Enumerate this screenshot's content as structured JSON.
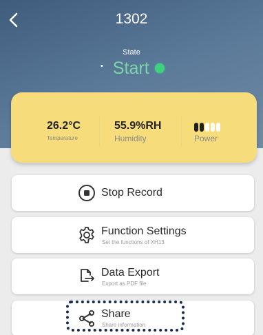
{
  "header": {
    "title": "1302",
    "state_label": "State",
    "state_value": "Start"
  },
  "stats": {
    "temperature_value": "26.2°C",
    "temperature_label": "Temperature",
    "humidity_value": "55.9%RH",
    "humidity_label": "Humidity",
    "power_label": "Power",
    "power_level": 0.4
  },
  "actions": [
    {
      "label": "Stop Record",
      "sub": "",
      "icon": "stop-circle-icon"
    },
    {
      "label": "Function Settings",
      "sub": "Set the functions of XH13",
      "icon": "gear-icon"
    },
    {
      "label": "Data Export",
      "sub": "Export as PDF file",
      "icon": "export-icon"
    },
    {
      "label": "Share",
      "sub": "Share information",
      "icon": "share-icon"
    }
  ],
  "colors": {
    "header": "#4b6a8c",
    "stats_card": "#f6dc7a",
    "state_text": "#7ad6a8",
    "state_dot": "#3fd27e",
    "highlight_border": "#152a52"
  }
}
